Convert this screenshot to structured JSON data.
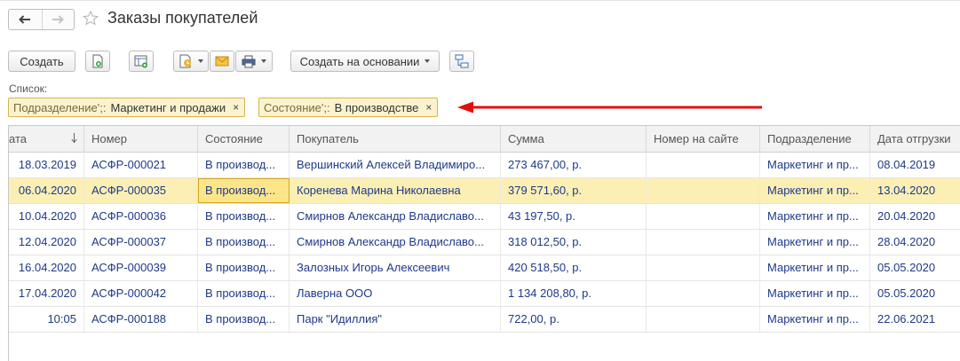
{
  "title": "Заказы покупателей",
  "toolbar": {
    "create_label": "Создать",
    "create_based_label": "Создать на основании"
  },
  "list_label": "Список:",
  "filters": [
    {
      "key": "Подразделение';:",
      "value": "Маркетинг и продажи"
    },
    {
      "key": "Состояние';:",
      "value": "В производстве"
    }
  ],
  "filter_close_glyph": "×",
  "colors": {
    "arrow": "#e01010",
    "chip_bg": "#fbf3cf",
    "chip_border": "#d9b24a",
    "row_text": "#1d3a8a",
    "selected_row": "#fcefb4"
  },
  "columns": [
    "ата",
    "Номер",
    "Состояние",
    "Покупатель",
    "Сумма",
    "Номер на сайте",
    "Подразделение",
    "Дата отгрузки"
  ],
  "rows": [
    [
      "18.03.2019",
      "АСФР-000021",
      "В производ...",
      "Вершинский Алексей Владимиро...",
      "273 467,00, р.",
      "",
      "Маркетинг и пр...",
      "08.04.2019"
    ],
    [
      "06.04.2020",
      "АСФР-000035",
      "В производ...",
      "Коренева Марина Николаевна",
      "379 571,60, р.",
      "",
      "Маркетинг и пр...",
      "13.04.2020"
    ],
    [
      "10.04.2020",
      "АСФР-000036",
      "В производ...",
      "Смирнов Александр Владиславо...",
      "43 197,50, р.",
      "",
      "Маркетинг и пр...",
      "20.04.2020"
    ],
    [
      "12.04.2020",
      "АСФР-000037",
      "В производ...",
      "Смирнов Александр Владиславо...",
      "318 012,50, р.",
      "",
      "Маркетинг и пр...",
      "28.04.2020"
    ],
    [
      "16.04.2020",
      "АСФР-000039",
      "В производ...",
      "Залозных Игорь Алексеевич",
      "420 518,50, р.",
      "",
      "Маркетинг и пр...",
      "05.05.2020"
    ],
    [
      "17.04.2020",
      "АСФР-000042",
      "В производ...",
      "Лаверна ООО",
      "1 134 208,80, р.",
      "",
      "Маркетинг и пр...",
      "05.05.2020"
    ],
    [
      "10:05",
      "АСФР-000188",
      "В производ...",
      "Парк \"Идиллия\"",
      "722,00, р.",
      "",
      "Маркетинг и пр...",
      "22.06.2021"
    ]
  ]
}
